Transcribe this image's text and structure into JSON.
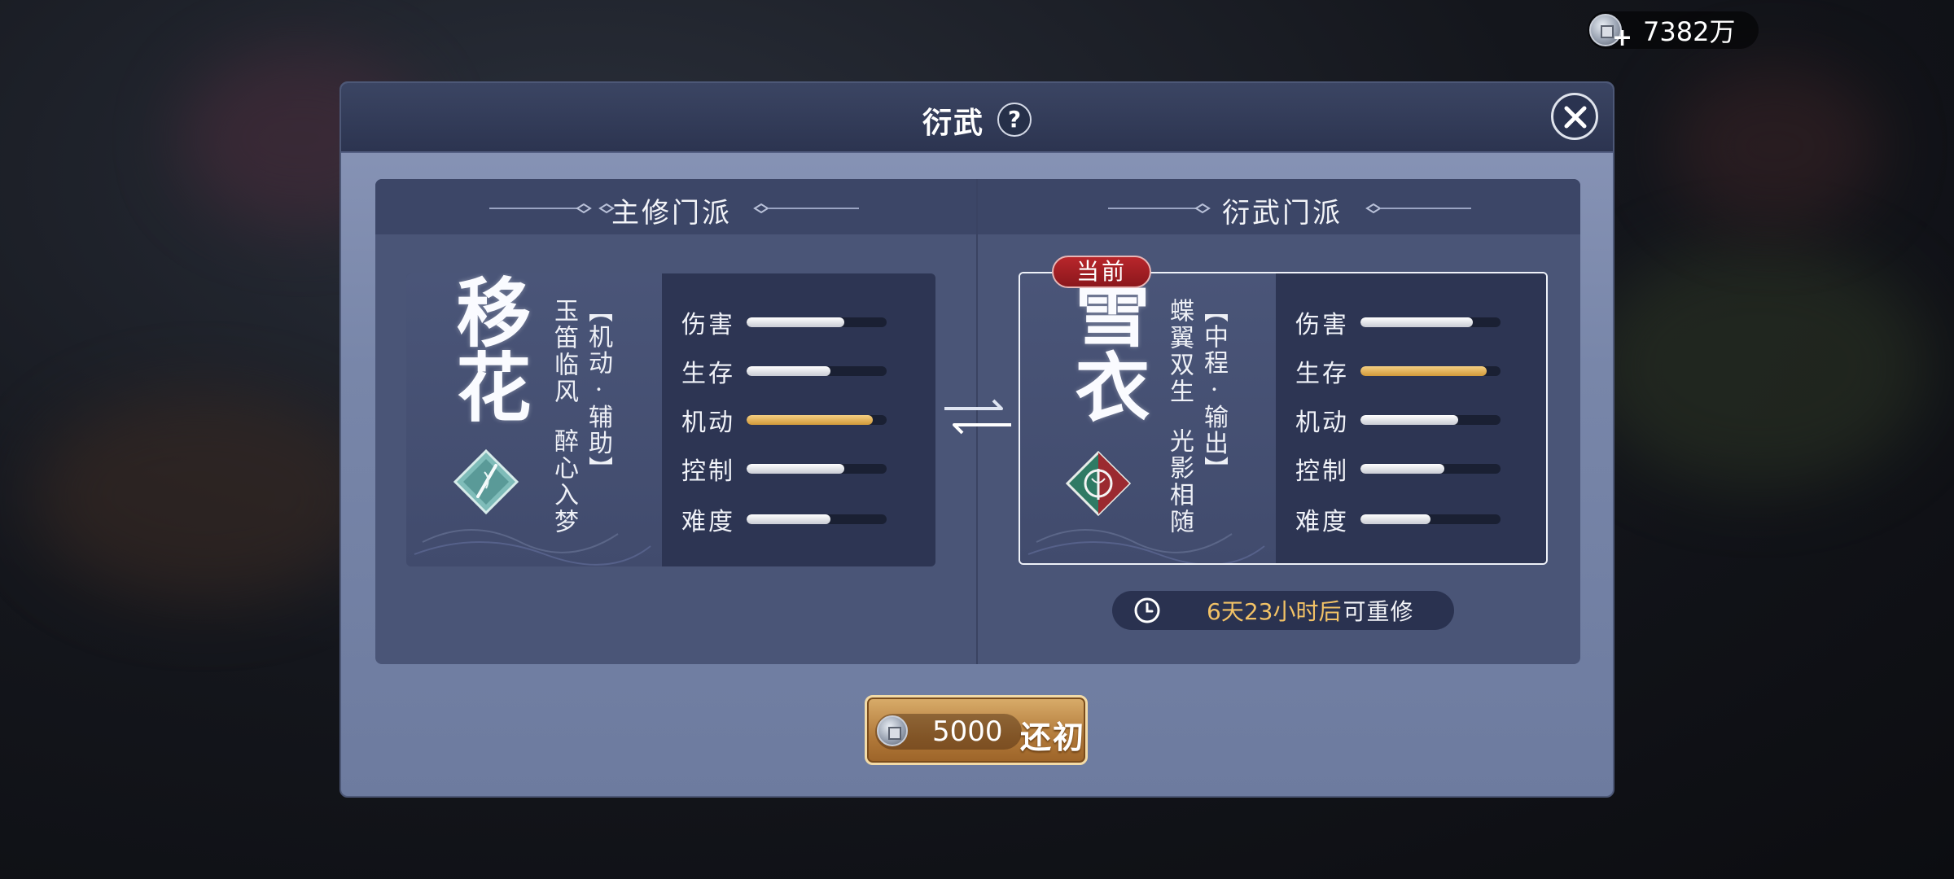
{
  "currency": {
    "icon": "silver-coin-icon",
    "plus_icon": "plus-icon",
    "amount": "7382万"
  },
  "dialog": {
    "title": "衍武",
    "help_label": "?",
    "close_icon": "close-icon"
  },
  "left_section": {
    "title": "主修门派",
    "school": {
      "name": "移花",
      "role": "【机动 · 辅助】",
      "skill_1": "玉笛临风",
      "skill_2": "醉心入梦",
      "emblem_icon": "yihua-emblem-icon",
      "stats": [
        {
          "label": "伤害",
          "value": 0.7,
          "highlight": false
        },
        {
          "label": "生存",
          "value": 0.6,
          "highlight": false
        },
        {
          "label": "机动",
          "value": 0.9,
          "highlight": true
        },
        {
          "label": "控制",
          "value": 0.7,
          "highlight": false
        },
        {
          "label": "难度",
          "value": 0.6,
          "highlight": false
        }
      ]
    }
  },
  "right_section": {
    "title": "衍武门派",
    "badge": "当前",
    "school": {
      "name": "雪衣",
      "role": "【中程 · 输出】",
      "skill_1": "蝶翼双生",
      "skill_2": "光影相随",
      "emblem_icon": "xueyi-emblem-icon",
      "stats": [
        {
          "label": "伤害",
          "value": 0.8,
          "highlight": false
        },
        {
          "label": "生存",
          "value": 0.9,
          "highlight": true
        },
        {
          "label": "机动",
          "value": 0.7,
          "highlight": false
        },
        {
          "label": "控制",
          "value": 0.6,
          "highlight": false
        },
        {
          "label": "难度",
          "value": 0.5,
          "highlight": false
        }
      ]
    },
    "timer": {
      "icon": "clock-icon",
      "time": "6天23小时后",
      "label": "可重修"
    }
  },
  "swap_icon": "swap-arrows-icon",
  "reset_button": {
    "icon": "silver-coin-icon",
    "cost": "5000",
    "label": "还初"
  },
  "colors": {
    "accent_gold": "#f2c266",
    "badge_red": "#b8262b",
    "button_gold": "#c38b47"
  }
}
